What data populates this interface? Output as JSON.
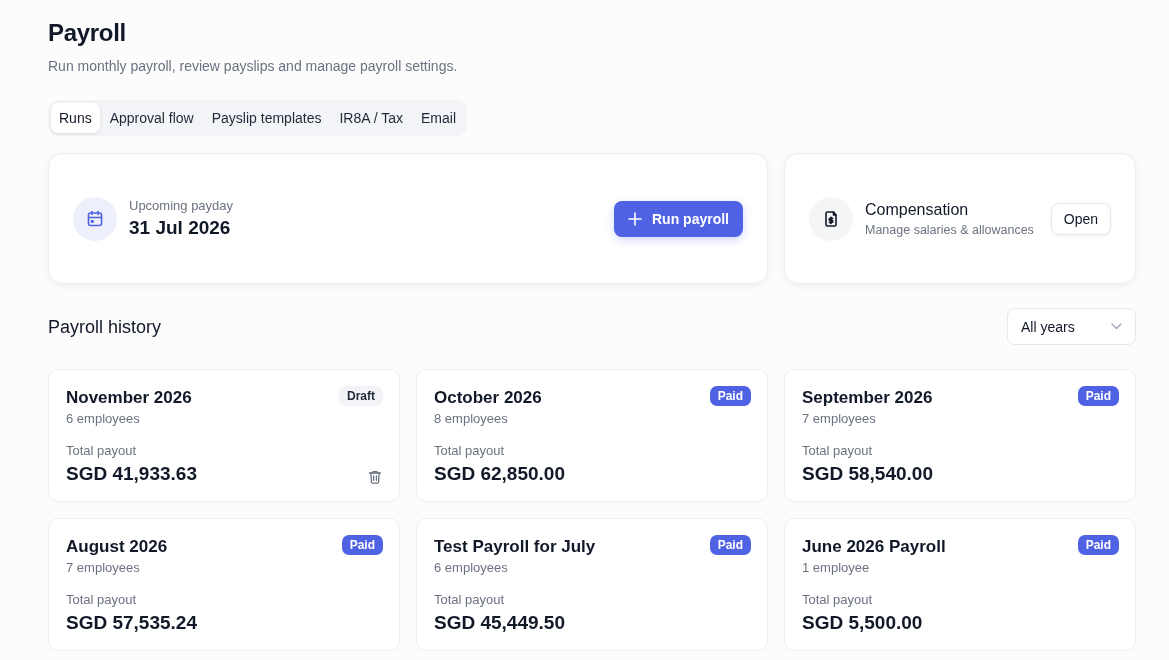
{
  "page": {
    "title": "Payroll",
    "subtitle": "Run monthly payroll, review payslips and manage payroll settings."
  },
  "tabs": [
    {
      "label": "Runs",
      "selected": true
    },
    {
      "label": "Approval flow",
      "selected": false
    },
    {
      "label": "Payslip templates",
      "selected": false
    },
    {
      "label": "IR8A / Tax",
      "selected": false
    },
    {
      "label": "Email",
      "selected": false
    }
  ],
  "payday_card": {
    "label": "Upcoming payday",
    "date": "31 Jul 2026",
    "button": "Run payroll"
  },
  "compensation_card": {
    "title": "Compensation",
    "subtitle": "Manage salaries & allowances",
    "button": "Open"
  },
  "history": {
    "title": "Payroll history",
    "filter": {
      "value": "All years"
    },
    "runs": [
      {
        "name": "November 2026",
        "employees": "6 employees",
        "total_label": "Total payout",
        "total": "SGD 41,933.63",
        "status": {
          "label": "Draft",
          "kind": "draft"
        },
        "deletable": true
      },
      {
        "name": "October 2026",
        "employees": "8 employees",
        "total_label": "Total payout",
        "total": "SGD 62,850.00",
        "status": {
          "label": "Paid",
          "kind": "paid"
        },
        "deletable": false
      },
      {
        "name": "September 2026",
        "employees": "7 employees",
        "total_label": "Total payout",
        "total": "SGD 58,540.00",
        "status": {
          "label": "Paid",
          "kind": "paid"
        },
        "deletable": false
      },
      {
        "name": "August 2026",
        "employees": "7 employees",
        "total_label": "Total payout",
        "total": "SGD 57,535.24",
        "status": {
          "label": "Paid",
          "kind": "paid"
        },
        "deletable": false
      },
      {
        "name": "Test Payroll for July",
        "employees": "6 employees",
        "total_label": "Total payout",
        "total": "SGD 45,449.50",
        "status": {
          "label": "Paid",
          "kind": "paid"
        },
        "deletable": false
      },
      {
        "name": "June 2026 Payroll",
        "employees": "1 employee",
        "total_label": "Total payout",
        "total": "SGD 5,500.00",
        "status": {
          "label": "Paid",
          "kind": "paid"
        },
        "deletable": false
      }
    ]
  }
}
